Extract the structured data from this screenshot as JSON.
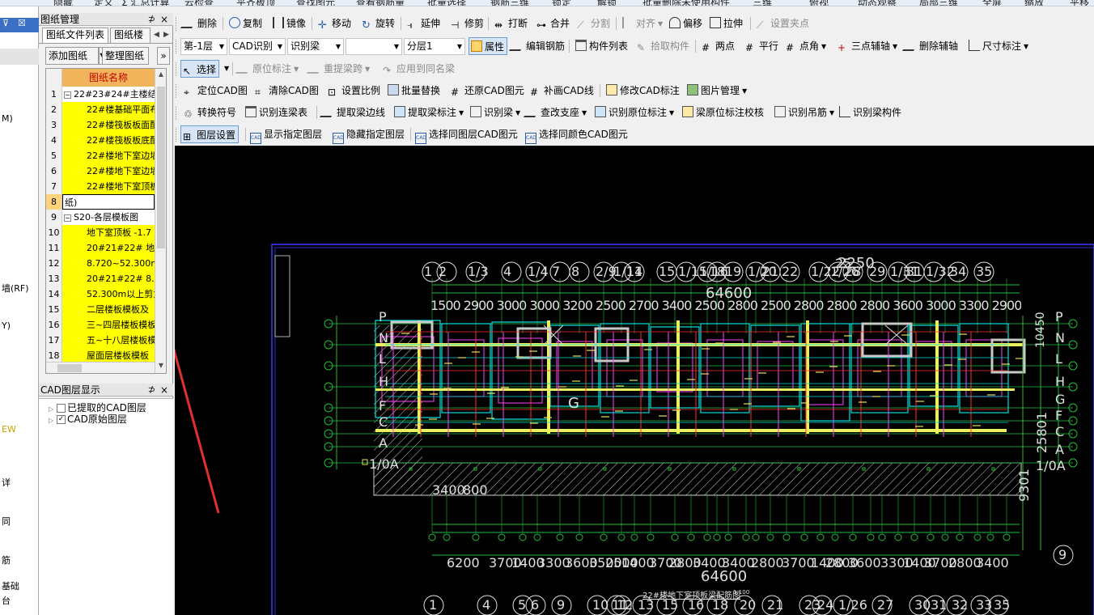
{
  "top_toolbar": {
    "items": [
      "隐藏",
      "定义",
      "Σ 汇总计算",
      "云检查",
      "平齐板顶",
      "查找图元",
      "查看钢筋量",
      "批量选择",
      "钢筋三维",
      "锁定",
      "解锁",
      "批量删除未使用构件",
      "三维",
      "俯视",
      "动态观察",
      "局部三维",
      "全屏",
      "缩放",
      "平移"
    ]
  },
  "left_strip": {
    "items": [
      "M)",
      "墙(RF)",
      "Y)",
      "EW",
      "详",
      "同",
      "筋",
      "基础",
      "台"
    ]
  },
  "drawing_panel": {
    "title": "图纸管理",
    "pin": "⊅",
    "close": "×",
    "tabs": [
      "图纸文件列表",
      "图纸楼"
    ],
    "add_button": "添加图纸",
    "organize_button": "整理图纸",
    "more": "»",
    "header": "图纸名称",
    "rows": [
      {
        "n": "1",
        "text": "22#23#24#主楼结构",
        "type": "group"
      },
      {
        "n": "2",
        "text": "22#楼基础平面布",
        "type": "y"
      },
      {
        "n": "3",
        "text": "22#楼筏板板面配",
        "type": "y"
      },
      {
        "n": "4",
        "text": "22#楼筏板板底配",
        "type": "y"
      },
      {
        "n": "5",
        "text": "22#楼地下室边墙",
        "type": "y"
      },
      {
        "n": "6",
        "text": "22#楼地下室边墙",
        "type": "y"
      },
      {
        "n": "7",
        "text": "22#楼地下室顶板",
        "type": "y"
      },
      {
        "n": "8",
        "text": "纸)",
        "type": "sel"
      },
      {
        "n": "9",
        "text": "S20-各层模板图",
        "type": "group"
      },
      {
        "n": "10",
        "text": "地下室顶板 -1.7",
        "type": "y"
      },
      {
        "n": "11",
        "text": "20#21#22# 地下",
        "type": "y"
      },
      {
        "n": "12",
        "text": "8.720~52.300m",
        "type": "y"
      },
      {
        "n": "13",
        "text": "20#21#22#  8.",
        "type": "y"
      },
      {
        "n": "14",
        "text": "52.300m以上剪力",
        "type": "y"
      },
      {
        "n": "15",
        "text": "二层楼板模板及",
        "type": "y"
      },
      {
        "n": "16",
        "text": "三~四层楼板模板",
        "type": "y"
      },
      {
        "n": "17",
        "text": "五~十八层楼板模",
        "type": "y"
      },
      {
        "n": "18",
        "text": "屋面层楼板模板",
        "type": "y"
      }
    ]
  },
  "layer_panel": {
    "title": "CAD图层显示",
    "items": [
      {
        "label": "已提取的CAD图层",
        "checked": false
      },
      {
        "label": "CAD原始图层",
        "checked": true
      }
    ]
  },
  "toolbar_row1": [
    "删除",
    "复制",
    "镜像",
    "移动",
    "旋转",
    "延伸",
    "修剪",
    "打断",
    "合并",
    "分割",
    "对齐",
    "偏移",
    "拉伸",
    "设置夹点"
  ],
  "toolbar_row2": {
    "floor": "第-1层",
    "mode": "CAD识别",
    "component": "识别梁",
    "blank": "",
    "sublayer": "分层1",
    "items": [
      "属性",
      "编辑钢筋",
      "构件列表",
      "拾取构件",
      "两点",
      "平行",
      "点角",
      "三点辅轴",
      "删除辅轴",
      "尺寸标注"
    ]
  },
  "toolbar_row3": [
    "选择",
    "原位标注",
    "重提梁跨",
    "应用到同名梁"
  ],
  "toolbar_row4": [
    "定位CAD图",
    "清除CAD图",
    "设置比例",
    "批量替换",
    "还原CAD图元",
    "补画CAD线",
    "修改CAD标注",
    "图片管理"
  ],
  "toolbar_row5": [
    "转换符号",
    "识别连梁表",
    "提取梁边线",
    "提取梁标注",
    "识别梁",
    "查改支座",
    "识别原位标注",
    "梁原位标注校核",
    "识别吊筋",
    "识别梁构件"
  ],
  "toolbar_row6": [
    "图层设置",
    "显示指定图层",
    "隐藏指定图层",
    "选择同图层CAD图元",
    "选择同颜色CAD图元"
  ],
  "cad": {
    "top_axes": [
      "1",
      "2",
      "1/3",
      "4",
      "1/4",
      "7",
      "8",
      "2/9",
      "1/11",
      "14",
      "15",
      "1/15",
      "1/16",
      "18",
      "19",
      "1/20",
      "21",
      "22",
      "1/22",
      "1/26",
      "28",
      "29",
      "1/31",
      "31",
      "1/32",
      "34",
      "35"
    ],
    "top_dim_total": "64600",
    "top_center_axis": "25",
    "top_dims": "1500 2900 3000 3000 3200 2500 2700 3400 2500 2800 2500 2800 2800 2800 3600 3000 3300 2900 3000 2900 2500 2800 2500 3000 2700 2500 2800 2800 3000 2600 1800 2900 3600",
    "bottom_dims": [
      "6200",
      "3700",
      "1400",
      "3300",
      "3600",
      "3500",
      "2500",
      "1400",
      "3700",
      "2800",
      "3400",
      "3400",
      "2800",
      "3700",
      "1400",
      "2800",
      "3600",
      "3300",
      "1400",
      "3700",
      "2800",
      "3400"
    ],
    "bottom_total": "64600",
    "bottom_axes": [
      "1",
      "4",
      "5",
      "6",
      "9",
      "10",
      "11",
      "12",
      "13",
      "15",
      "16",
      "18",
      "20",
      "21",
      "23",
      "24",
      "1/26",
      "27",
      "30",
      "31",
      "32",
      "33",
      "35"
    ],
    "left_rows": [
      "P",
      "N",
      "L",
      "H",
      "F",
      "C",
      "A",
      "1/0A"
    ],
    "right_rows": [
      "P",
      "N",
      "L",
      "H",
      "G",
      "F",
      "C",
      "A",
      "1/0A"
    ],
    "center_dim": "2250",
    "grid_label_g": "G",
    "bottom_left_dim": "3400",
    "bottom_left_dim2": "800",
    "right_vertical_dim": "9301",
    "right_axis_9": "9",
    "right_dim2": "25801",
    "right_dim3": "10450",
    "title": "22#楼地下室顶板梁配筋图",
    "scale": "1:100"
  }
}
